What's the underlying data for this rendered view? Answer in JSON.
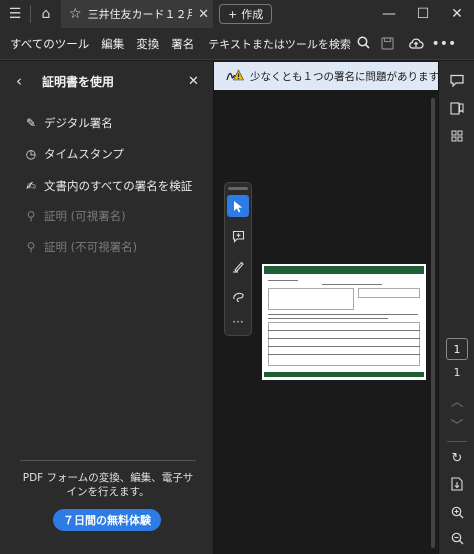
{
  "titlebar": {
    "menu_icon": "hamburger-icon",
    "home_icon": "home-icon",
    "tab_title": "三井住友カード１２月...",
    "new_tab_label": "作成"
  },
  "menubar": {
    "items": [
      "すべてのツール",
      "編集",
      "変換",
      "署名"
    ],
    "search_label": "テキストまたはツールを検索"
  },
  "left_panel": {
    "title": "証明書を使用",
    "items": [
      {
        "label": "デジタル署名",
        "icon": "digital-signature-icon",
        "enabled": true
      },
      {
        "label": "タイムスタンプ",
        "icon": "timestamp-icon",
        "enabled": true
      },
      {
        "label": "文書内のすべての署名を検証",
        "icon": "validate-signatures-icon",
        "enabled": true
      },
      {
        "label": "証明 (可視署名)",
        "icon": "certify-visible-icon",
        "enabled": false
      },
      {
        "label": "証明 (不可視署名)",
        "icon": "certify-invisible-icon",
        "enabled": false
      }
    ],
    "promo_text": "PDF フォームの変換、編集、電子サインを行えます。",
    "trial_button": "７日間の無料体験"
  },
  "notice": {
    "text": "少なくとも１つの署名に問題があります。",
    "icon": "signature-warning-icon"
  },
  "page_nav": {
    "current_page": "1",
    "total_pages": "1"
  },
  "colors": {
    "accent": "#2d7be5",
    "panel_bg": "#2b2b2b",
    "doc_bg": "#1a1a1a",
    "notice_bg": "#dfe9f6"
  }
}
